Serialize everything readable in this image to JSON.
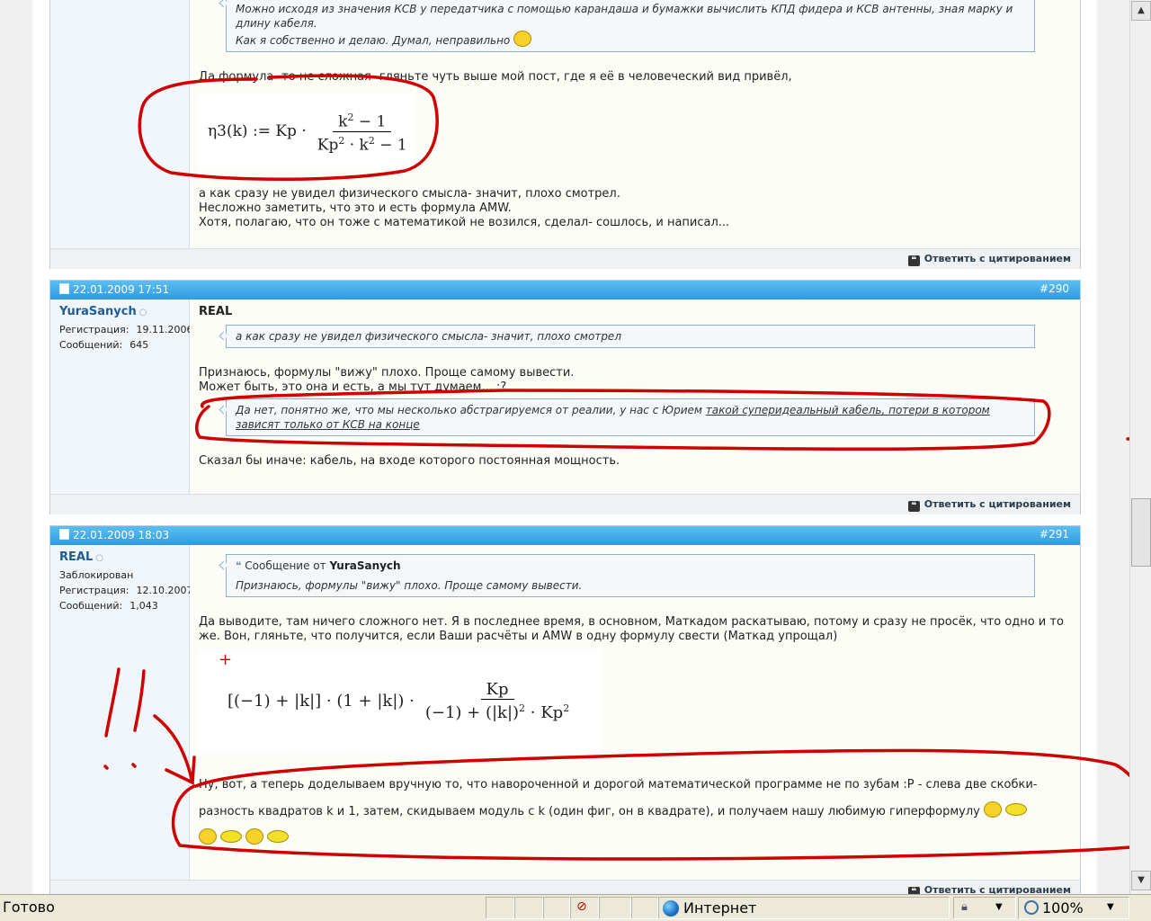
{
  "post_top": {
    "quote_line1": "Можно исходя из значения КСВ у передатчика с помощью карандаша и бумажки вычислить КПД фидера и КСВ антенны, зная марку и длину кабеля.",
    "quote_line2": "Как я собственно и делаю. Думал, неправильно",
    "text_intro": "Да формула- то не сложная- гляньте чуть выше мой пост, где я её в человеческий вид привёл,",
    "formula_lhs": "η3(k) := Kp ·",
    "formula_num": "k",
    "formula_num_tail": " − 1",
    "formula_den_a": "Kp",
    "formula_den_b": " · k",
    "formula_den_tail": " − 1",
    "sq": "2",
    "line1": "а как сразу не увидел физического смысла- значит, плохо смотрел.",
    "line2": "Несложно заметить, что это и есть формула AMW.",
    "line3": "Хотя, полагаю, что он тоже с математикой не возился, сделал- сошлось, и написал...",
    "reply_label": "Ответить с цитированием"
  },
  "post_290": {
    "date": "22.01.2009 17:51",
    "num": "#290",
    "username": "YuraSanych",
    "status_icon": "○",
    "reg_label": "Регистрация:",
    "reg_value": "19.11.2006",
    "msgs_label": "Сообщений:",
    "msgs_value": "645",
    "quoted_name": "REAL",
    "quote1": "а как сразу не увидел физического смысла- значит, плохо смотрел",
    "text1": "Признаюсь, формулы \"вижу\" плохо. Проще самому вывести.",
    "text2": "Может быть, это она и есть, а мы тут думаем... :?",
    "quote2_plain": "Да нет, понятно же, что мы несколько абстрагируемся от реалии, у нас с Юрием ",
    "quote2_underlined": "такой суперидеальный кабель, потери в котором зависят только от КСВ на конце",
    "text3": "Сказал бы иначе: кабель, на входе которого постоянная мощность.",
    "reply_label": "Ответить с цитированием"
  },
  "post_291": {
    "date": "22.01.2009 18:03",
    "num": "#291",
    "username": "REAL",
    "status_icon": "○",
    "blocked": "Заблокирован",
    "reg_label": "Регистрация:",
    "reg_value": "12.10.2007",
    "msgs_label": "Сообщений:",
    "msgs_value": "1,043",
    "quote_header_prefix": "Сообщение от",
    "quote_author": "YuraSanych",
    "quote_text": "Признаюсь, формулы \"вижу\" плохо. Проще самому вывести.",
    "text1": "Да выводите, там ничего сложного нет. Я в последнее время, в основном, Маткадом раскатываю, потому и сразу не просёк, что одно и то же. Вон, гляньте, что получится, если Ваши расчёты и AMW в одну формулу свести (Маткад упрощал)",
    "f2_lhs": "[(−1) + |k|] · (1 + |k|) ·",
    "f2_num": "Kp",
    "f2_den_a": "(−1) + (|k|)",
    "f2_den_b": " · Kp",
    "sq": "2",
    "f2_cursor": "+",
    "text2": "Ну, вот, а теперь доделываем вручную то, что навороченной и дорогой математической программе не по зубам :P - слева две скобки-",
    "text3": "разность квадратов k и 1, затем, скидываем модуль с k (один фиг, он в квадрате), и получаем нашу любимую гиперформулу",
    "reply_label": "Ответить с цитированием"
  },
  "scrollbar": {
    "up_icon": "▲",
    "down_icon": "▼"
  },
  "statusbar": {
    "status": "Готово",
    "zone": "Интернет",
    "zoom": "100%",
    "dropdown_icon": "▼"
  },
  "colors": {
    "header_blue": "#3fa8e6",
    "annotation_red": "#d00000",
    "link_blue": "#1f5c93"
  }
}
